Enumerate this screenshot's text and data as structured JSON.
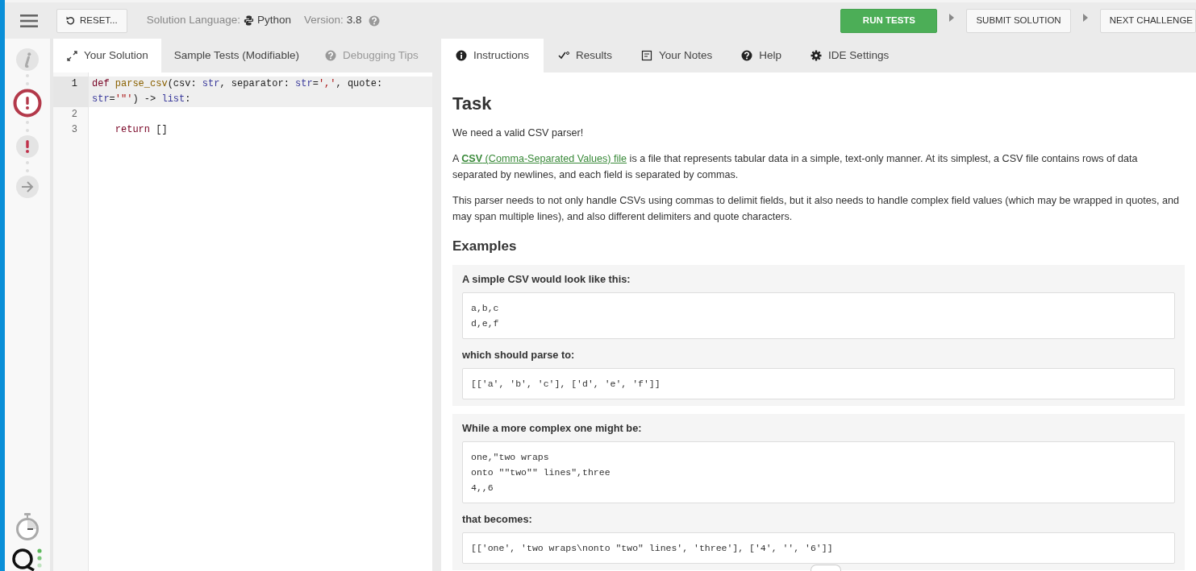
{
  "toolbar": {
    "reset_label": "RESET...",
    "language_label": "Solution Language:",
    "language": "Python",
    "version_label": "Version:",
    "version": "3.8",
    "actions": [
      {
        "label": "RUN TESTS",
        "kind": "primary"
      },
      {
        "label": "SUBMIT SOLUTION",
        "kind": "secondary"
      },
      {
        "label": "NEXT CHALLENGE",
        "kind": "secondary"
      }
    ]
  },
  "sidebar": {
    "steps": [
      {
        "kind": "info",
        "selected": false
      },
      {
        "kind": "error",
        "selected": true
      },
      {
        "kind": "error",
        "selected": false
      },
      {
        "kind": "next",
        "selected": false
      }
    ]
  },
  "editor": {
    "tabs": [
      {
        "label": "Your Solution",
        "kind": "expand",
        "selected": true,
        "disabled": false
      },
      {
        "label": "Sample Tests (Modifiable)",
        "kind": "plain",
        "selected": false,
        "disabled": false
      },
      {
        "label": "Debugging Tips",
        "kind": "help",
        "selected": false,
        "disabled": true
      }
    ],
    "lines": [
      {
        "number": "1",
        "active": true,
        "tokens": [
          {
            "kind": "keyword",
            "text": "def "
          },
          {
            "kind": "defname",
            "text": "parse_csv"
          },
          {
            "kind": "plain",
            "text": "(csv: "
          },
          {
            "kind": "builtin",
            "text": "str"
          },
          {
            "kind": "plain",
            "text": ", separator: "
          },
          {
            "kind": "builtin",
            "text": "str"
          },
          {
            "kind": "plain",
            "text": "="
          },
          {
            "kind": "string",
            "text": "','"
          },
          {
            "kind": "plain",
            "text": ", quote: "
          },
          {
            "kind": "builtin",
            "text": "str"
          },
          {
            "kind": "plain",
            "text": "="
          },
          {
            "kind": "string",
            "text": "'\"'"
          },
          {
            "kind": "plain",
            "text": ") -> "
          },
          {
            "kind": "builtin",
            "text": "list"
          },
          {
            "kind": "plain",
            "text": ":"
          }
        ]
      },
      {
        "number": "2",
        "active": false
      },
      {
        "number": "3",
        "active": false,
        "tokens": [
          {
            "kind": "keyword",
            "text": "    return"
          },
          {
            "kind": "plain",
            "text": " []"
          }
        ]
      }
    ]
  },
  "panel": {
    "tabs": [
      {
        "label": "Instructions",
        "kind": "info",
        "selected": true
      },
      {
        "label": "Results",
        "kind": "results",
        "selected": false
      },
      {
        "label": "Your Notes",
        "kind": "notes",
        "selected": false
      },
      {
        "label": "Help",
        "kind": "help",
        "selected": false
      },
      {
        "label": "IDE Settings",
        "kind": "gear",
        "selected": false
      }
    ],
    "title": "Task",
    "intro": "We need a valid CSV parser!",
    "definition": {
      "before": "A ",
      "link": "**CSV** (Comma-Separated Values) file",
      "after": " is a file that represents tabular data in a simple, text-only manner. At its simplest, a CSV file contains rows of data separated by newlines, and each field is separated by commas."
    },
    "requirement": "This parser needs to not only handle CSVs using commas to delimit fields, but it also needs to handle complex field values (which may be wrapped in quotes, and may span multiple lines), and also different delimiters and quote characters.",
    "examples_title": "Examples",
    "examples": [
      {
        "input_label": "A simple CSV would look like this:",
        "input": "a,b,c\nd,e,f",
        "output_label": "which should parse to:",
        "output": "[['a', 'b', 'c'], ['d', 'e', 'f']]"
      },
      {
        "input_label": "While a more complex one might be:",
        "input": "one,\"two wraps\nonto \"\"two\"\" lines\",three\n4,,6",
        "output_label": "that becomes:",
        "output": "[['one', 'two wraps\\nonto \"two\" lines', 'three'], ['4', '', '6']]"
      }
    ]
  }
}
